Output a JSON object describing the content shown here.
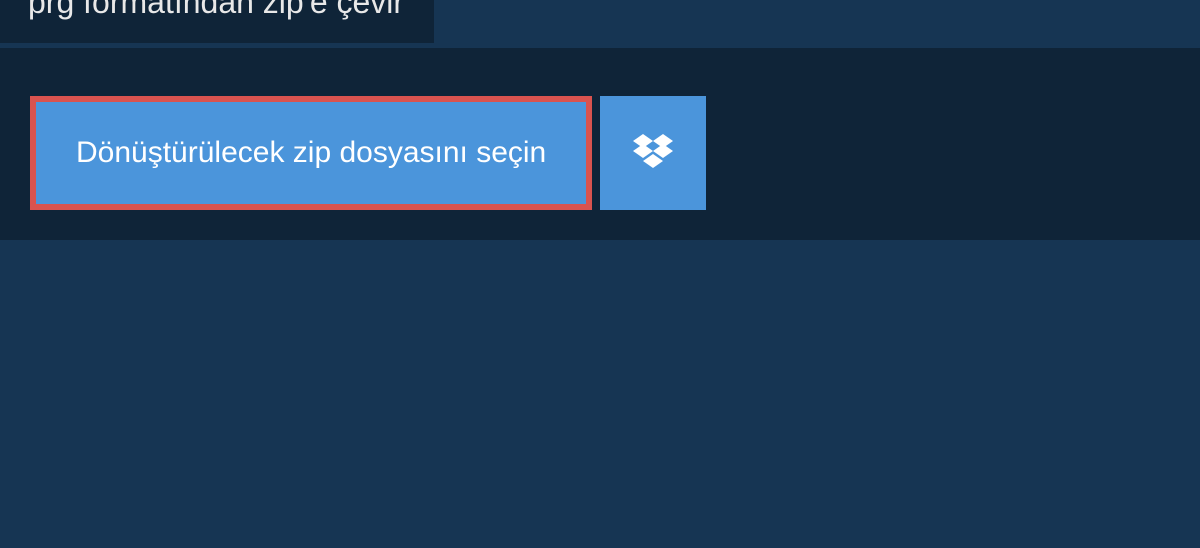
{
  "header": {
    "tab_label": "prg formatından zip'e çevir"
  },
  "upload": {
    "file_select_label": "Dönüştürülecek zip dosyasını seçin"
  },
  "colors": {
    "background": "#163553",
    "panel": "#0f2438",
    "button_primary": "#4b95db",
    "button_border": "#d9534f"
  }
}
